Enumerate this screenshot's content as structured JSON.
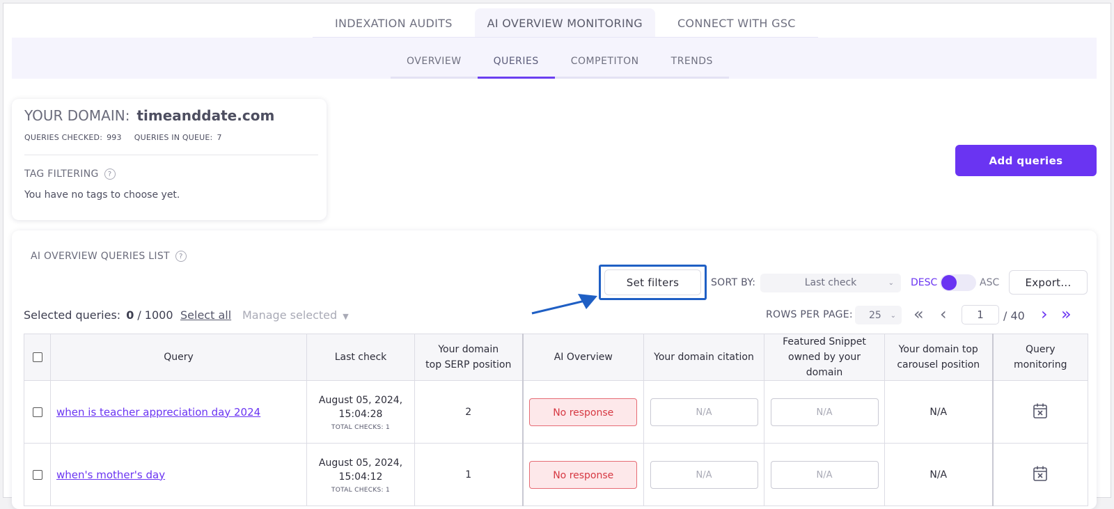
{
  "top_tabs": [
    {
      "label": "INDEXATION AUDITS"
    },
    {
      "label": "AI OVERVIEW MONITORING"
    },
    {
      "label": "CONNECT WITH GSC"
    }
  ],
  "sub_tabs": [
    {
      "label": "OVERVIEW"
    },
    {
      "label": "QUERIES"
    },
    {
      "label": "COMPETITON"
    },
    {
      "label": "TRENDS"
    }
  ],
  "domain_card": {
    "title_label": "YOUR DOMAIN:",
    "domain": "timeanddate.com",
    "queries_checked_label": "QUERIES CHECKED:",
    "queries_checked": "993",
    "queries_in_queue_label": "QUERIES IN QUEUE:",
    "queries_in_queue": "7",
    "tag_filtering_label": "TAG FILTERING",
    "tag_filtering_text": "You have no tags to choose yet."
  },
  "add_queries_label": "Add queries",
  "list": {
    "title": "AI OVERVIEW QUERIES LIST",
    "set_filters_label": "Set filters",
    "sort_by_label": "SORT BY:",
    "sort_by_value": "Last check",
    "desc_label": "DESC",
    "asc_label": "ASC",
    "export_label": "Export...",
    "selected_label": "Selected queries:",
    "selected_count": "0",
    "selected_max": "/ 1000",
    "select_all_label": "Select all",
    "manage_selected_label": "Manage selected",
    "rows_per_page_label": "ROWS PER PAGE:",
    "rows_per_page_value": "25",
    "page_value": "1",
    "page_total": "/ 40"
  },
  "icons": {
    "help": "?",
    "first": "«",
    "prev": "‹",
    "next": "›",
    "last": "»",
    "chevron": "⌄",
    "caret": "▼"
  },
  "table": {
    "headers": {
      "query": "Query",
      "last_check": "Last check",
      "serp_1": "Your domain",
      "serp_2": "top SERP position",
      "ai_overview": "AI Overview",
      "citation": "Your domain citation",
      "snippet_1": "Featured Snippet",
      "snippet_2": "owned by your domain",
      "carousel_1": "Your domain top",
      "carousel_2": "carousel position",
      "monitoring_1": "Query",
      "monitoring_2": "monitoring"
    },
    "rows": [
      {
        "query": "when is teacher appreciation day 2024",
        "last_check_date": "August 05, 2024,",
        "last_check_time": "15:04:28",
        "total_checks": "TOTAL CHECKS: 1",
        "serp_position": "2",
        "ai_overview": "No response",
        "citation": "N/A",
        "snippet": "N/A",
        "carousel": "N/A"
      },
      {
        "query": "when's mother's day",
        "last_check_date": "August 05, 2024,",
        "last_check_time": "15:04:12",
        "total_checks": "TOTAL CHECKS: 1",
        "serp_position": "1",
        "ai_overview": "No response",
        "citation": "N/A",
        "snippet": "N/A",
        "carousel": "N/A"
      }
    ]
  },
  "colors": {
    "accent": "#6a34f2",
    "highlight_border": "#1f5fc4",
    "error_text": "#d63842",
    "error_bg": "#fde8ea"
  }
}
